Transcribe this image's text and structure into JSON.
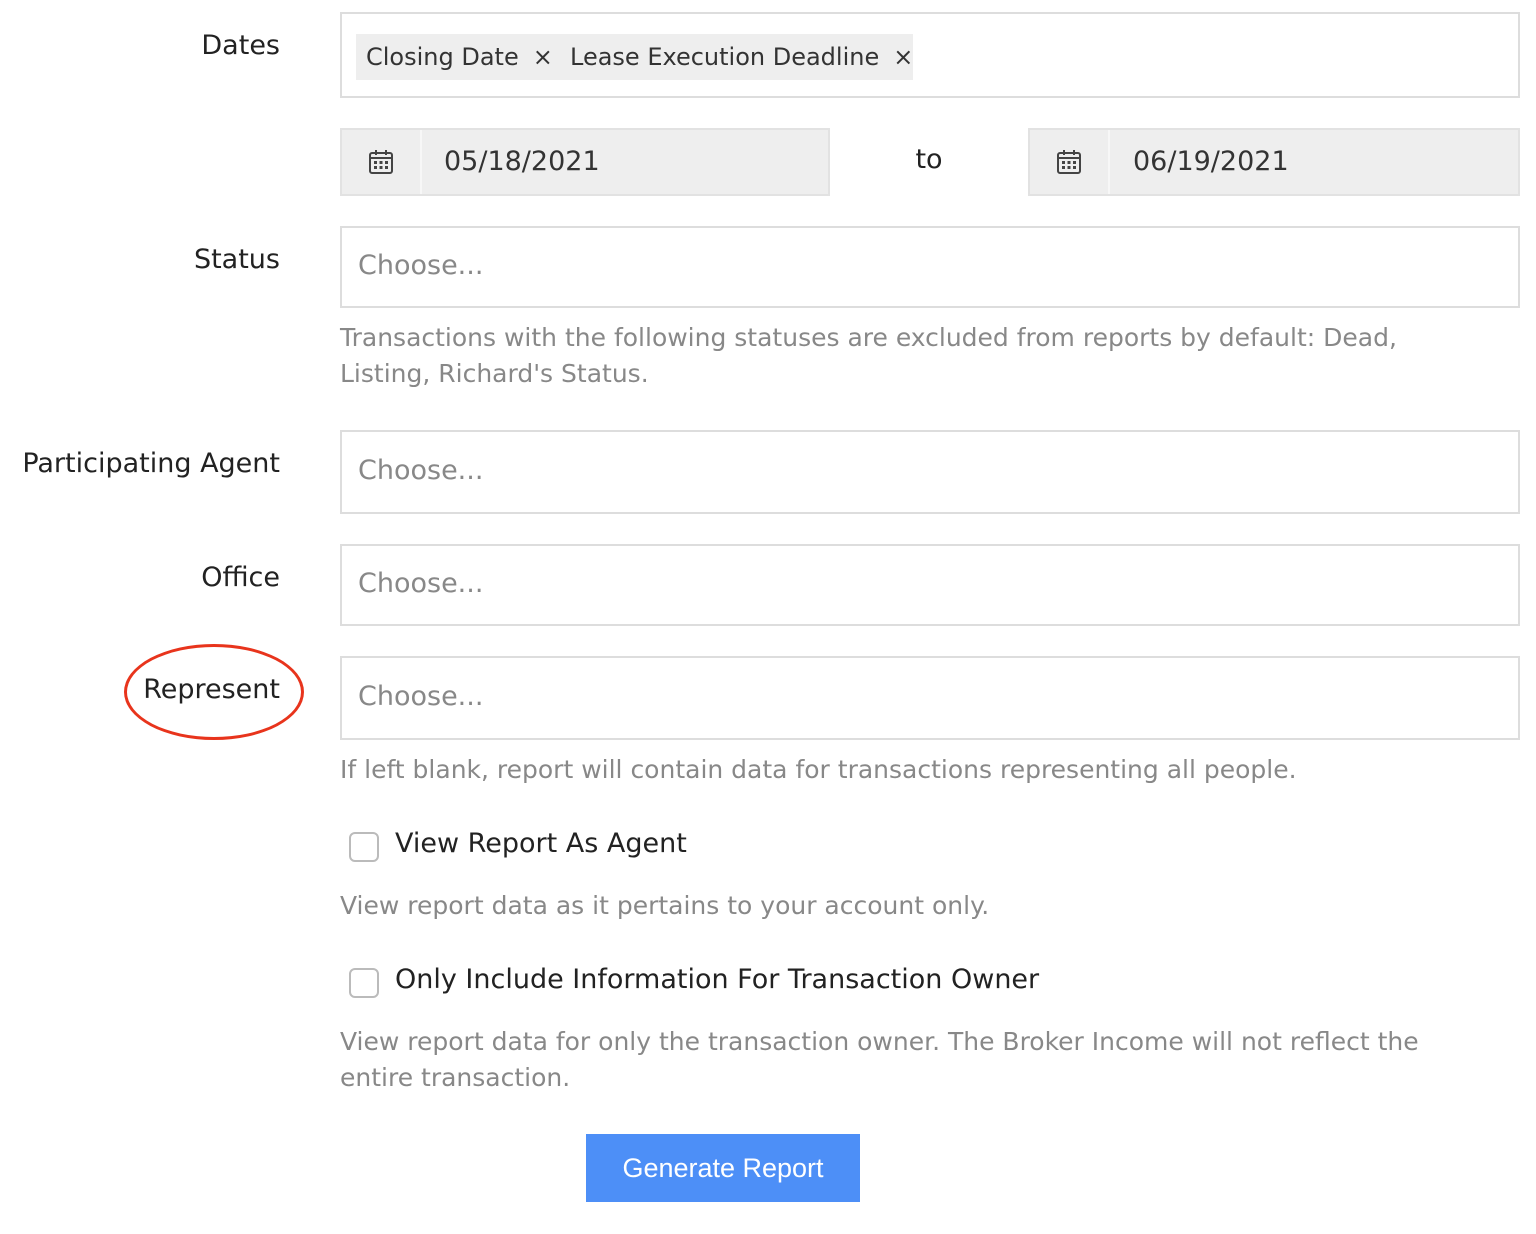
{
  "dates": {
    "label": "Dates",
    "tags": [
      {
        "text": "Closing Date",
        "remove": "×"
      },
      {
        "text": "Lease Execution Deadline",
        "remove": "×"
      }
    ],
    "from": "05/18/2021",
    "to_label": "to",
    "to": "06/19/2021"
  },
  "status": {
    "label": "Status",
    "placeholder": "Choose...",
    "help": "Transactions with the following statuses are excluded from reports by default: Dead, Listing, Richard's Status."
  },
  "participating_agent": {
    "label": "Participating Agent",
    "placeholder": "Choose..."
  },
  "office": {
    "label": "Office",
    "placeholder": "Choose..."
  },
  "represent": {
    "label": "Represent",
    "placeholder": "Choose...",
    "help": "If left blank, report will contain data for transactions representing all people."
  },
  "view_as_agent": {
    "label": "View Report As Agent",
    "checked": false,
    "help": "View report data as it pertains to your account only."
  },
  "owner_only": {
    "label": "Only Include Information For Transaction Owner",
    "checked": false,
    "help": "View report data for only the transaction owner. The Broker Income will not reflect the entire transaction."
  },
  "generate_button": "Generate Report",
  "colors": {
    "accent": "#4d8ff7",
    "highlight": "#e8341c"
  }
}
